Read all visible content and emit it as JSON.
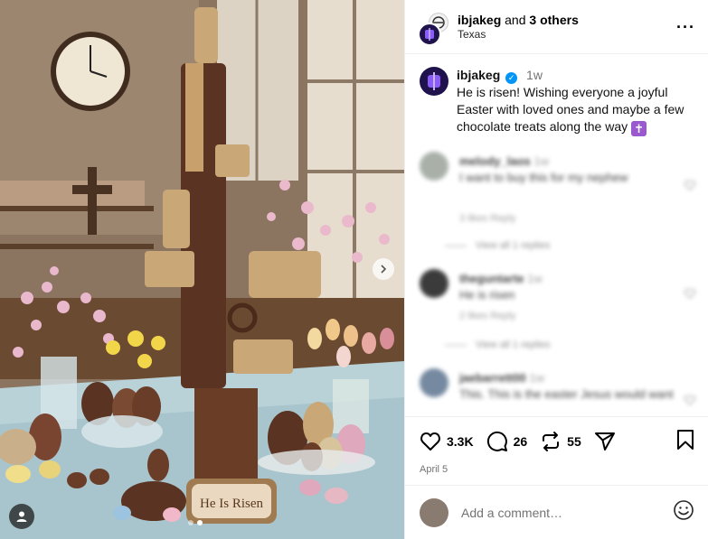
{
  "post": {
    "image_alt": "Chocolate rifle sculpture on an Easter table with eggs, flowers and a He Is Risen sign",
    "sign_text": "He Is Risen",
    "carousel_index": 2,
    "carousel_count": 2
  },
  "header": {
    "username": "ibjakeg",
    "connector": " and ",
    "others": "3 others",
    "location": "Texas",
    "more_label": "···"
  },
  "caption": {
    "username": "ibjakeg",
    "verified_mark": "✓",
    "time": "1w",
    "text": "He is risen! Wishing everyone a joyful Easter with loved ones and maybe a few chocolate treats along the way",
    "emoji": "✝"
  },
  "comments": [
    {
      "user": "melody_laos",
      "time": "1w",
      "text": "I want to buy this for my nephew",
      "meta": "3 likes   Reply",
      "replies": "View all 1 replies",
      "avatar_color": "#9aa39a"
    },
    {
      "user": "theguntarte",
      "time": "1w",
      "text": "He is risen",
      "meta": "2 likes   Reply",
      "replies": "View all 1 replies",
      "avatar_color": "#1a1a1a"
    },
    {
      "user": "jaebarrett00",
      "time": "1w",
      "text": "This. This is the easter Jesus would want",
      "meta": "",
      "replies": "",
      "avatar_color": "#5d7590"
    }
  ],
  "actions": {
    "likes": "3.3K",
    "comments": "26",
    "reposts": "55",
    "date": "April 5"
  },
  "add_comment": {
    "placeholder": "Add a comment…"
  },
  "colors": {
    "verified": "#0095f6",
    "avatar_bg": "#20124d",
    "emoji_bg": "#9b59d0"
  }
}
